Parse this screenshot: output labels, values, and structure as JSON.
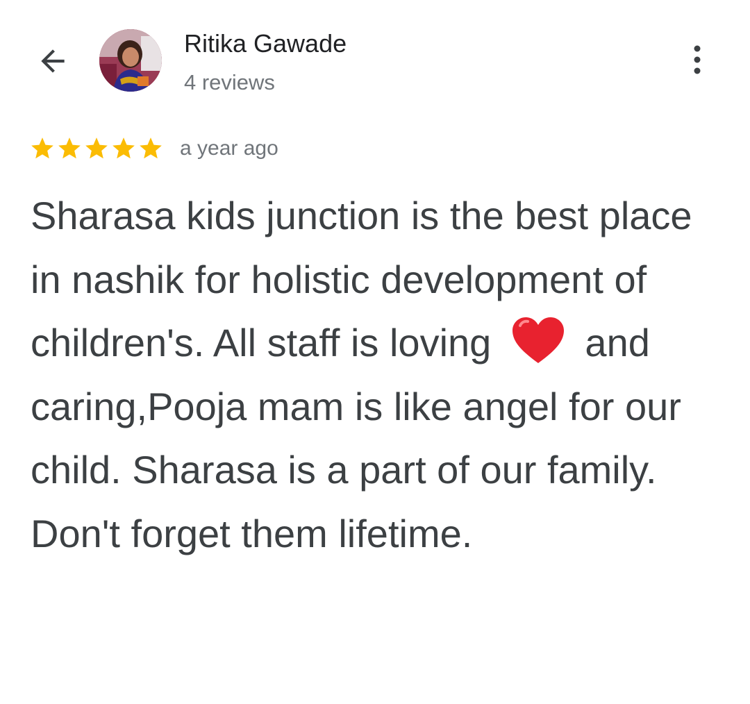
{
  "header": {
    "back_icon": "arrow-left-icon",
    "avatar_icon": "reviewer-photo",
    "reviewer_name": "Ritika Gawade",
    "review_count": "4 reviews",
    "more_icon": "more-vert-icon"
  },
  "review": {
    "rating": 5,
    "rating_max": 5,
    "star_color": "#fbbc04",
    "time": "a year ago",
    "text_before_emoji": "Sharasa kids junction is the best place in nashik for holistic development of children's. All staff is loving",
    "emoji_icon": "red-heart-emoji",
    "text_after_emoji": "and caring,Pooja mam is like angel for our child. Sharasa is a part of our family. Don't forget them lifetime."
  }
}
